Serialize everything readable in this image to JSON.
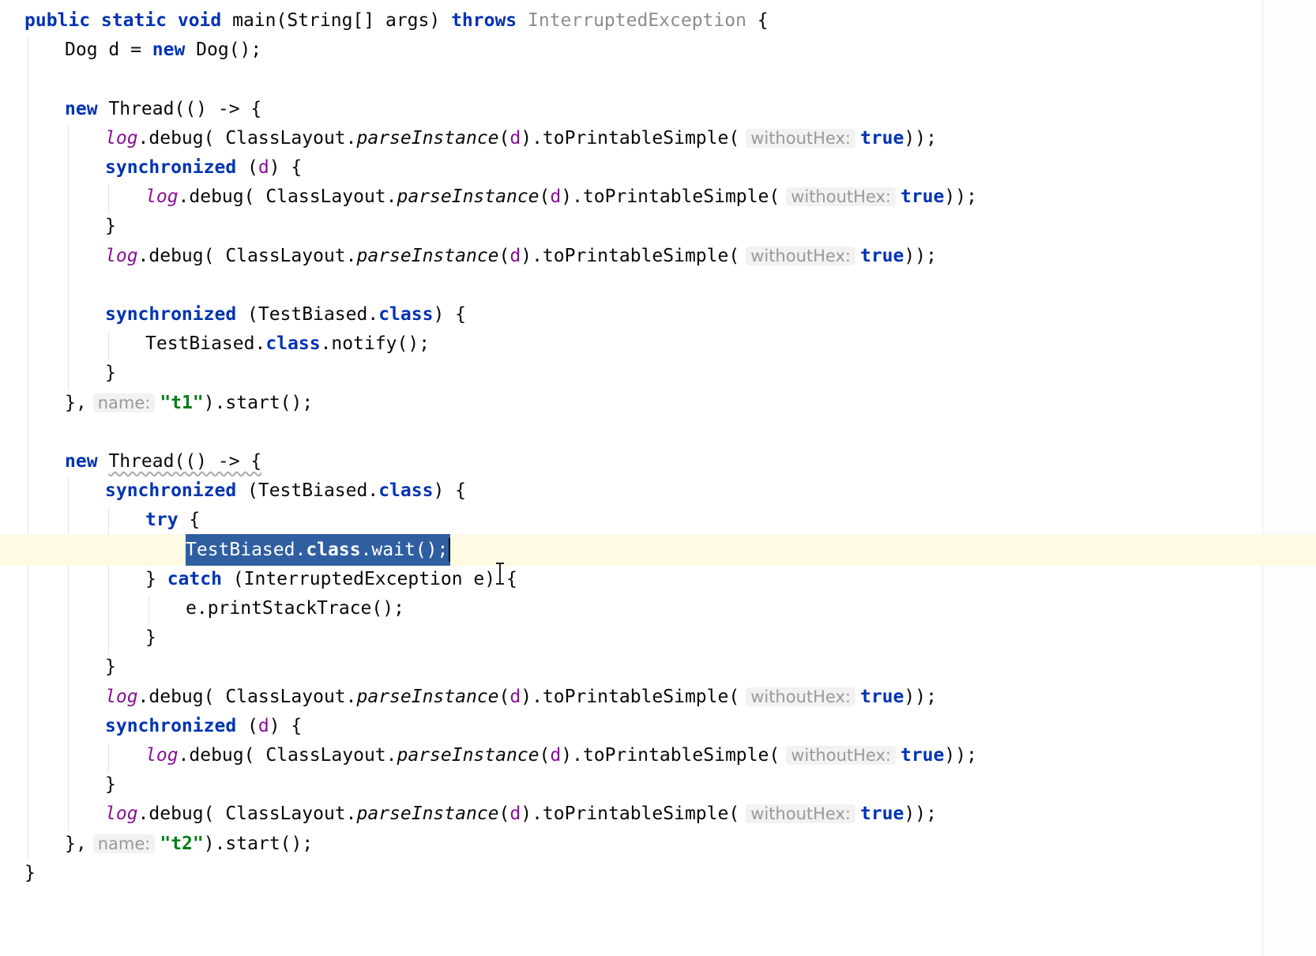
{
  "editor": {
    "lines": [
      {
        "indent": 0,
        "tokens": [
          {
            "t": "public static void ",
            "c": "kw"
          },
          {
            "t": "main(String[] args) "
          },
          {
            "t": "throws ",
            "c": "kw"
          },
          {
            "t": "InterruptedException",
            "c": "dim"
          },
          {
            "t": " {"
          }
        ]
      },
      {
        "indent": 1,
        "tokens": [
          {
            "t": "Dog d = "
          },
          {
            "t": "new ",
            "c": "kw"
          },
          {
            "t": "Dog();"
          }
        ]
      },
      {
        "indent": 0,
        "tokens": []
      },
      {
        "indent": 1,
        "tokens": [
          {
            "t": "new ",
            "c": "kw"
          },
          {
            "t": "Thread(() -> {"
          }
        ]
      },
      {
        "indent": 2,
        "tokens": [
          {
            "t": "log",
            "c": "log"
          },
          {
            "t": ".debug( ClassLayout."
          },
          {
            "t": "parseInstance",
            "c": "it"
          },
          {
            "t": "("
          },
          {
            "t": "d",
            "c": "param"
          },
          {
            "t": ").toPrintableSimple("
          },
          {
            "t": "withoutHex:",
            "c": "hint"
          },
          {
            "t": "true",
            "c": "kw"
          },
          {
            "t": "));"
          }
        ]
      },
      {
        "indent": 2,
        "tokens": [
          {
            "t": "synchronized ",
            "c": "kw"
          },
          {
            "t": "("
          },
          {
            "t": "d",
            "c": "param"
          },
          {
            "t": ") {"
          }
        ]
      },
      {
        "indent": 3,
        "tokens": [
          {
            "t": "log",
            "c": "log"
          },
          {
            "t": ".debug( ClassLayout."
          },
          {
            "t": "parseInstance",
            "c": "it"
          },
          {
            "t": "("
          },
          {
            "t": "d",
            "c": "param"
          },
          {
            "t": ").toPrintableSimple("
          },
          {
            "t": "withoutHex:",
            "c": "hint"
          },
          {
            "t": "true",
            "c": "kw"
          },
          {
            "t": "));"
          }
        ]
      },
      {
        "indent": 2,
        "tokens": [
          {
            "t": "}"
          }
        ]
      },
      {
        "indent": 2,
        "tokens": [
          {
            "t": "log",
            "c": "log"
          },
          {
            "t": ".debug( ClassLayout."
          },
          {
            "t": "parseInstance",
            "c": "it"
          },
          {
            "t": "("
          },
          {
            "t": "d",
            "c": "param"
          },
          {
            "t": ").toPrintableSimple("
          },
          {
            "t": "withoutHex:",
            "c": "hint"
          },
          {
            "t": "true",
            "c": "kw"
          },
          {
            "t": "));"
          }
        ]
      },
      {
        "indent": 0,
        "tokens": []
      },
      {
        "indent": 2,
        "tokens": [
          {
            "t": "synchronized ",
            "c": "kw"
          },
          {
            "t": "(TestBiased."
          },
          {
            "t": "class",
            "c": "kw"
          },
          {
            "t": ") {"
          }
        ]
      },
      {
        "indent": 3,
        "tokens": [
          {
            "t": "TestBiased."
          },
          {
            "t": "class",
            "c": "kw"
          },
          {
            "t": ".notify();"
          }
        ]
      },
      {
        "indent": 2,
        "tokens": [
          {
            "t": "}"
          }
        ]
      },
      {
        "indent": 1,
        "tokens": [
          {
            "t": "},"
          },
          {
            "t": "name:",
            "c": "hint"
          },
          {
            "t": "\"t1\"",
            "c": "str"
          },
          {
            "t": ").start();"
          }
        ]
      },
      {
        "indent": 0,
        "tokens": []
      },
      {
        "indent": 1,
        "squiggle": true,
        "tokens": [
          {
            "t": "new ",
            "c": "kw"
          },
          {
            "t": "Thread(() -> {"
          }
        ]
      },
      {
        "indent": 2,
        "tokens": [
          {
            "t": "synchronized ",
            "c": "kw"
          },
          {
            "t": "(TestBiased."
          },
          {
            "t": "class",
            "c": "kw"
          },
          {
            "t": ") {"
          }
        ]
      },
      {
        "indent": 3,
        "tokens": [
          {
            "t": "try ",
            "c": "kw"
          },
          {
            "t": "{"
          }
        ]
      },
      {
        "indent": 4,
        "current": true,
        "selected": true,
        "tokens": [
          {
            "t": "TestBiased."
          },
          {
            "t": "class",
            "c": "kw"
          },
          {
            "t": ".wait();"
          }
        ]
      },
      {
        "indent": 3,
        "tokens": [
          {
            "t": "} "
          },
          {
            "t": "catch ",
            "c": "kw"
          },
          {
            "t": "(InterruptedException e) {"
          }
        ]
      },
      {
        "indent": 4,
        "tokens": [
          {
            "t": "e.printStackTrace();"
          }
        ]
      },
      {
        "indent": 3,
        "tokens": [
          {
            "t": "}"
          }
        ]
      },
      {
        "indent": 2,
        "tokens": [
          {
            "t": "}"
          }
        ]
      },
      {
        "indent": 2,
        "tokens": [
          {
            "t": "log",
            "c": "log"
          },
          {
            "t": ".debug( ClassLayout."
          },
          {
            "t": "parseInstance",
            "c": "it"
          },
          {
            "t": "("
          },
          {
            "t": "d",
            "c": "param"
          },
          {
            "t": ").toPrintableSimple("
          },
          {
            "t": "withoutHex:",
            "c": "hint"
          },
          {
            "t": "true",
            "c": "kw"
          },
          {
            "t": "));"
          }
        ]
      },
      {
        "indent": 2,
        "tokens": [
          {
            "t": "synchronized ",
            "c": "kw"
          },
          {
            "t": "("
          },
          {
            "t": "d",
            "c": "param"
          },
          {
            "t": ") {"
          }
        ]
      },
      {
        "indent": 3,
        "tokens": [
          {
            "t": "log",
            "c": "log"
          },
          {
            "t": ".debug( ClassLayout."
          },
          {
            "t": "parseInstance",
            "c": "it"
          },
          {
            "t": "("
          },
          {
            "t": "d",
            "c": "param"
          },
          {
            "t": ").toPrintableSimple("
          },
          {
            "t": "withoutHex:",
            "c": "hint"
          },
          {
            "t": "true",
            "c": "kw"
          },
          {
            "t": "));"
          }
        ]
      },
      {
        "indent": 2,
        "tokens": [
          {
            "t": "}"
          }
        ]
      },
      {
        "indent": 2,
        "tokens": [
          {
            "t": "log",
            "c": "log"
          },
          {
            "t": ".debug( ClassLayout."
          },
          {
            "t": "parseInstance",
            "c": "it"
          },
          {
            "t": "("
          },
          {
            "t": "d",
            "c": "param"
          },
          {
            "t": ").toPrintableSimple("
          },
          {
            "t": "withoutHex:",
            "c": "hint"
          },
          {
            "t": "true",
            "c": "kw"
          },
          {
            "t": "));"
          }
        ]
      },
      {
        "indent": 1,
        "tokens": [
          {
            "t": "},"
          },
          {
            "t": "name:",
            "c": "hint"
          },
          {
            "t": "\"t2\"",
            "c": "str"
          },
          {
            "t": ").start();"
          }
        ]
      },
      {
        "indent": 0,
        "tokens": [
          {
            "t": "}"
          }
        ]
      }
    ]
  },
  "colors": {
    "keyword": "#0033b3",
    "string": "#067d17",
    "field": "#871094",
    "selection": "#2f5fa0",
    "current_line": "#fffae3"
  },
  "icons": {
    "text_cursor": "i-beam-icon"
  }
}
